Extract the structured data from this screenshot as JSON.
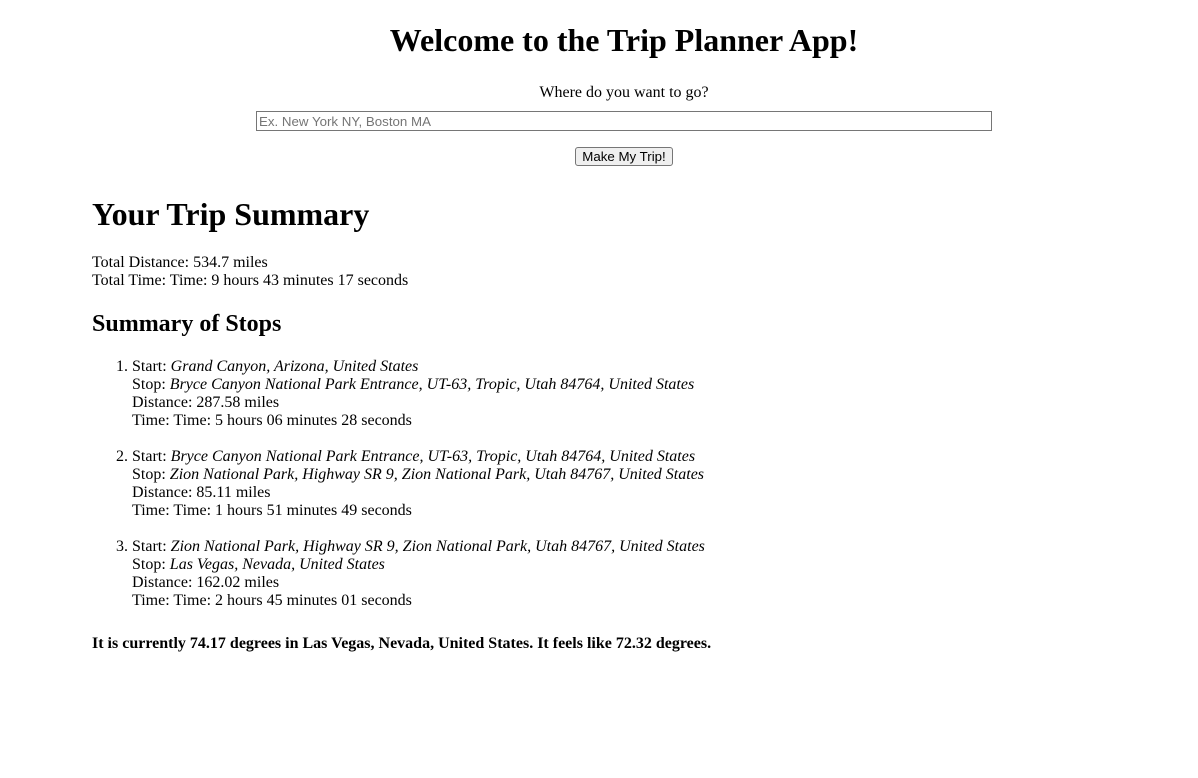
{
  "header": {
    "title": "Welcome to the Trip Planner App!",
    "prompt": "Where do you want to go?",
    "input_placeholder": "Ex. New York NY, Boston MA",
    "input_value": "",
    "button_label": "Make My Trip!"
  },
  "summary": {
    "title": "Your Trip Summary",
    "total_distance_label": "Total Distance:",
    "total_distance": "534.7 miles",
    "total_time_label": "Total Time:",
    "total_time": "Time: 9 hours 43 minutes 17 seconds",
    "stops_title": "Summary of Stops",
    "start_label": "Start:",
    "stop_label": "Stop:",
    "distance_label": "Distance:",
    "time_label": "Time:",
    "stops": [
      {
        "start": "Grand Canyon, Arizona, United States",
        "stop": "Bryce Canyon National Park Entrance, UT-63, Tropic, Utah 84764, United States",
        "distance": "287.58 miles",
        "time": "Time: 5 hours 06 minutes 28 seconds"
      },
      {
        "start": "Bryce Canyon National Park Entrance, UT-63, Tropic, Utah 84764, United States",
        "stop": "Zion National Park, Highway SR 9, Zion National Park, Utah 84767, United States",
        "distance": "85.11 miles",
        "time": "Time: 1 hours 51 minutes 49 seconds"
      },
      {
        "start": "Zion National Park, Highway SR 9, Zion National Park, Utah 84767, United States",
        "stop": "Las Vegas, Nevada, United States",
        "distance": "162.02 miles",
        "time": "Time: 2 hours 45 minutes 01 seconds"
      }
    ]
  },
  "weather": {
    "text": "It is currently 74.17 degrees in Las Vegas, Nevada, United States. It feels like 72.32 degrees."
  }
}
